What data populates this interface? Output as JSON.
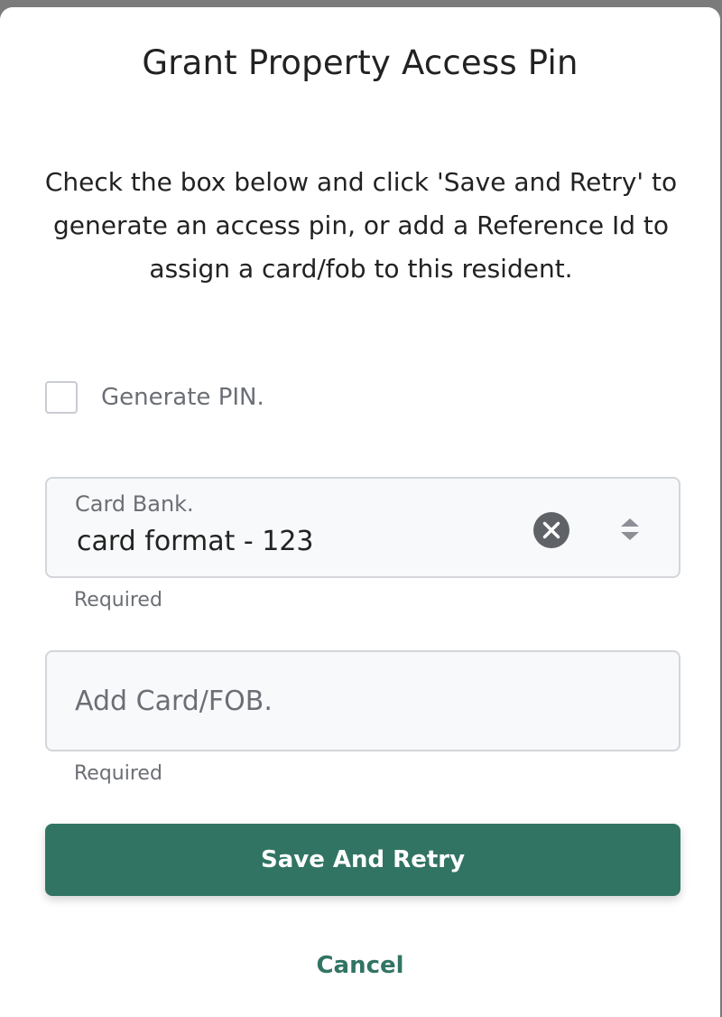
{
  "dialog": {
    "title": "Grant Property Access Pin",
    "description": "Check the box below and click 'Save and Retry' to generate an access pin, or add a Reference Id to assign a card/fob to this resident."
  },
  "generate_pin": {
    "label": "Generate PIN.",
    "checked": false
  },
  "card_bank": {
    "label": "Card Bank.",
    "value": "card format - 123",
    "helper": "Required",
    "icons": [
      "clear-icon",
      "sort-arrows-icon"
    ]
  },
  "card_fob": {
    "placeholder": "Add Card/FOB.",
    "value": "",
    "helper": "Required"
  },
  "actions": {
    "save_label": "Save And Retry",
    "cancel_label": "Cancel"
  },
  "colors": {
    "primary": "#327464",
    "overlay": "#7b7b7b",
    "clear_icon": "#5f6368"
  }
}
